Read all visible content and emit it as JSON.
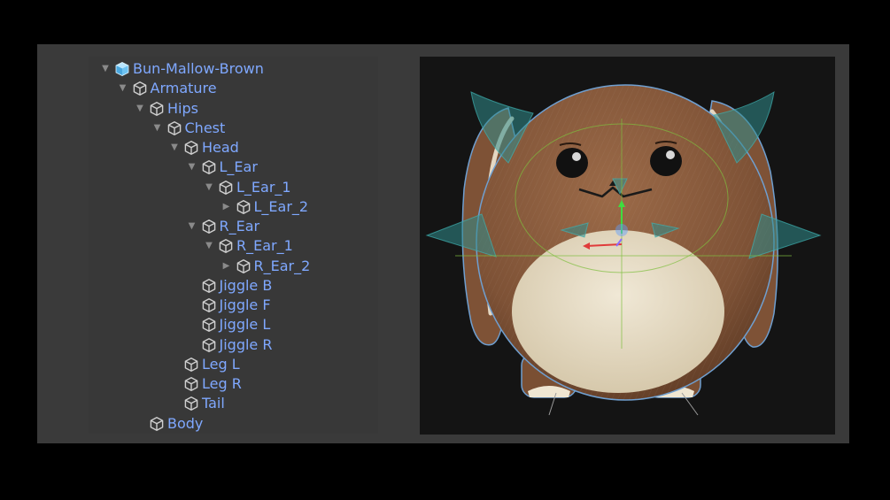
{
  "hierarchy": {
    "items": [
      {
        "label": "Bun-Mallow-Brown",
        "depth": 0,
        "expand": "open",
        "icon": "prefab-icon"
      },
      {
        "label": "Armature",
        "depth": 1,
        "expand": "open",
        "icon": "gameobject-icon"
      },
      {
        "label": "Hips",
        "depth": 2,
        "expand": "open",
        "icon": "gameobject-icon"
      },
      {
        "label": "Chest",
        "depth": 3,
        "expand": "open",
        "icon": "gameobject-icon"
      },
      {
        "label": "Head",
        "depth": 4,
        "expand": "open",
        "icon": "gameobject-icon"
      },
      {
        "label": "L_Ear",
        "depth": 5,
        "expand": "open",
        "icon": "gameobject-icon"
      },
      {
        "label": "L_Ear_1",
        "depth": 6,
        "expand": "open",
        "icon": "gameobject-icon"
      },
      {
        "label": "L_Ear_2",
        "depth": 7,
        "expand": "closed",
        "icon": "gameobject-icon"
      },
      {
        "label": "R_Ear",
        "depth": 5,
        "expand": "open",
        "icon": "gameobject-icon"
      },
      {
        "label": "R_Ear_1",
        "depth": 6,
        "expand": "open",
        "icon": "gameobject-icon"
      },
      {
        "label": "R_Ear_2",
        "depth": 7,
        "expand": "closed",
        "icon": "gameobject-icon"
      },
      {
        "label": "Jiggle B",
        "depth": 5,
        "expand": "none",
        "icon": "gameobject-icon"
      },
      {
        "label": "Jiggle F",
        "depth": 5,
        "expand": "none",
        "icon": "gameobject-icon"
      },
      {
        "label": "Jiggle L",
        "depth": 5,
        "expand": "none",
        "icon": "gameobject-icon"
      },
      {
        "label": "Jiggle R",
        "depth": 5,
        "expand": "none",
        "icon": "gameobject-icon"
      },
      {
        "label": "Leg L",
        "depth": 4,
        "expand": "none",
        "icon": "gameobject-icon"
      },
      {
        "label": "Leg R",
        "depth": 4,
        "expand": "none",
        "icon": "gameobject-icon"
      },
      {
        "label": "Tail",
        "depth": 4,
        "expand": "none",
        "icon": "gameobject-icon"
      },
      {
        "label": "Body",
        "depth": 2,
        "expand": "none",
        "icon": "gameobject-icon"
      }
    ]
  },
  "scene_view": {
    "subject": "bunny-character-model",
    "colors": {
      "fur": "#8a5a3c",
      "belly": "#e6dcc6",
      "collider": "#2f8c8c",
      "bone_lines": "#7fbf3f",
      "outline": "#6f9fd0"
    }
  },
  "colors": {
    "background": "#000000",
    "panel": "#3a3a3a",
    "hierarchy_bg": "#383838",
    "label": "#7fa8ff",
    "scene_bg": "#141414"
  }
}
